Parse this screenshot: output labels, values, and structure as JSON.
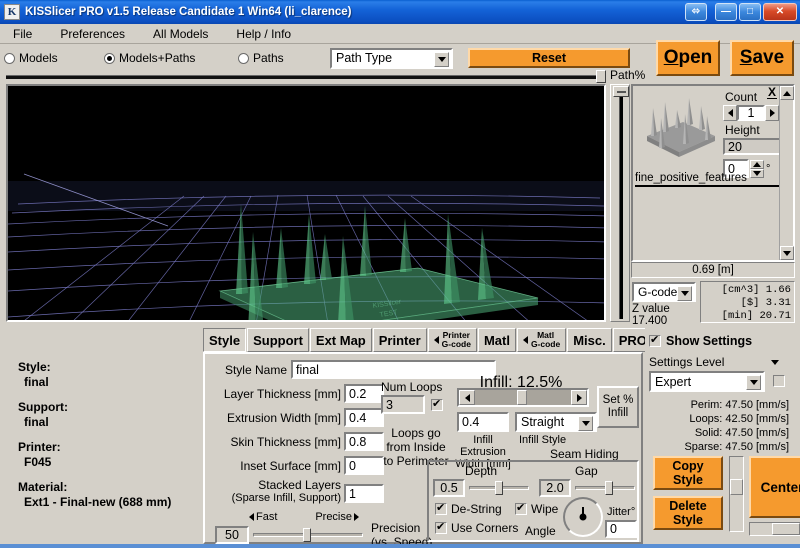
{
  "window": {
    "title": "KISSlicer PRO v1.5 Release Candidate 1 Win64 (li_clarence)",
    "app_icon": "kisslicer-logo-icon",
    "buttons": {
      "restore": "⬄",
      "minimize": "—",
      "maximize": "□",
      "close": "✕"
    }
  },
  "menu": {
    "items": [
      {
        "label": "File"
      },
      {
        "label": "Preferences"
      },
      {
        "label": "All Models"
      },
      {
        "label": "Help / Info"
      }
    ]
  },
  "toolbar": {
    "view_modes": [
      {
        "label": "Models",
        "selected": false
      },
      {
        "label": "Models+Paths",
        "selected": true
      },
      {
        "label": "Paths",
        "selected": false
      }
    ],
    "path_type_select": "Path Type",
    "reset_label": "Reset",
    "open_label": "Open",
    "open_accel": "O",
    "open_rest": "pen",
    "save_label": "Save",
    "save_accel": "S",
    "save_rest": "ave",
    "path_percent_label": "Path%"
  },
  "model_panel": {
    "close_label": "X",
    "count_label": "Count",
    "count_value": "1",
    "height_label": "Height",
    "height_value": "20",
    "rotation_value": "0",
    "degree_symbol": "°",
    "model_name": "fine_positive_features",
    "distance": "0.69 [m]"
  },
  "gcode": {
    "mode_select": "G-code",
    "z_label": "Z value",
    "z_value": "17.400",
    "stats": [
      {
        "unit": "[cm^3]",
        "value": "1.66"
      },
      {
        "unit": "[$]",
        "value": "3.31"
      },
      {
        "unit": "[min]",
        "value": "20.71"
      }
    ]
  },
  "summary": {
    "style_label": "Style:",
    "style_value": "final",
    "support_label": "Support:",
    "support_value": "final",
    "printer_label": "Printer:",
    "printer_value": "F045",
    "material_label": "Material:",
    "material_value": "Ext1 - Final-new (688 mm)"
  },
  "tabs": [
    {
      "label": "Style",
      "active": true
    },
    {
      "label": "Support",
      "active": false
    },
    {
      "label": "Ext Map",
      "active": false
    },
    {
      "label": "Printer",
      "active": false
    },
    {
      "label": "Printer",
      "label2": "G-code",
      "arrow": true,
      "active": false
    },
    {
      "label": "Matl",
      "active": false
    },
    {
      "label": "Matl",
      "label2": "G-code",
      "arrow": true,
      "active": false
    },
    {
      "label": "Misc.",
      "active": false
    },
    {
      "label": "PRO",
      "active": false
    }
  ],
  "style": {
    "style_name_label": "Style Name",
    "style_name_value": "final",
    "layer_thickness_label": "Layer Thickness [mm]",
    "layer_thickness_value": "0.2",
    "extrusion_width_label": "Extrusion Width [mm]",
    "extrusion_width_value": "0.4",
    "skin_thickness_label": "Skin Thickness [mm]",
    "skin_thickness_value": "0.8",
    "inset_surface_label": "Inset  Surface [mm]",
    "inset_surface_value": "0",
    "stacked_layers_label": "Stacked Layers",
    "stacked_layers_sub": "(Sparse Infill, Support)",
    "stacked_layers_value": "1",
    "precision_value": "50",
    "precision_fast": "Fast",
    "precision_precise": "Precise",
    "precision_label": "Precision",
    "precision_sub": "(vs. Speed)",
    "num_loops_label": "Num Loops",
    "num_loops_value": "3",
    "num_loops_checked": true,
    "loops_note_1": "Loops go",
    "loops_note_2": "from Inside",
    "loops_note_3": "to Perimeter",
    "infill_label": "Infill: 12.5%",
    "infill_percent": 12.5,
    "infill_ext_width_value": "0.4",
    "infill_ext_width_label_1": "Infill Extrusion",
    "infill_ext_width_label_2": "Width [mm]",
    "infill_style_value": "Straight",
    "infill_style_label": "Infill Style",
    "set_infill_label_1": "Set %",
    "set_infill_label_2": "Infill"
  },
  "seam": {
    "title": "Seam Hiding",
    "depth_label": "Depth",
    "depth_value": "0.5",
    "gap_label": "Gap",
    "gap_value": "2.0",
    "destring_label": "De-String",
    "destring_checked": true,
    "wipe_label": "Wipe",
    "wipe_checked": true,
    "use_corners_label": "Use Corners",
    "use_corners_checked": true,
    "angle_label": "Angle",
    "jitter_label": "Jitter°",
    "jitter_value": "0"
  },
  "settings": {
    "show_settings_label": "Show Settings",
    "show_settings_checked": true,
    "settings_level_label": "Settings Level",
    "settings_level_value": "Expert",
    "speeds": [
      {
        "name": "Perim:",
        "value": "47.50 [mm/s]"
      },
      {
        "name": "Loops:",
        "value": "42.50 [mm/s]"
      },
      {
        "name": "Solid:",
        "value": "47.50 [mm/s]"
      },
      {
        "name": "Sparse:",
        "value": "47.50 [mm/s]"
      }
    ],
    "copy_style_1": "Copy",
    "copy_style_2": "Style",
    "delete_style_1": "Delete",
    "delete_style_2": "Style",
    "center_label": "Center"
  },
  "colors": {
    "accent_orange": "#f59a2e",
    "face_gray": "#d4d0c8",
    "viewport_bg": "#000000",
    "grid_purple": "#8a8ad0",
    "model_green": "#5ec88a",
    "titlebar_blue": "#1463d8"
  }
}
